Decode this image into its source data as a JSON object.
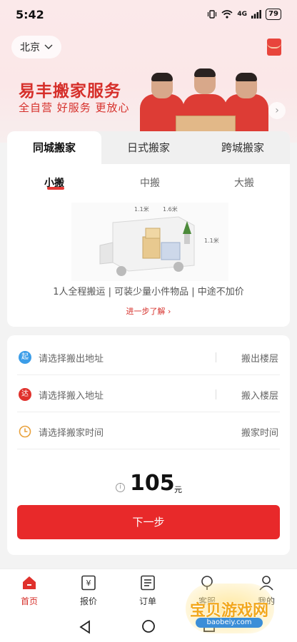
{
  "status_bar": {
    "time": "5:42",
    "network": "4G",
    "battery": "79"
  },
  "header": {
    "city": "北京"
  },
  "banner": {
    "title": "易丰搬家服务",
    "subtitle": "全自营 好服务 更放心"
  },
  "service_tabs": [
    {
      "label": "同城搬家",
      "active": true
    },
    {
      "label": "日式搬家",
      "active": false
    },
    {
      "label": "跨城搬家",
      "active": false
    }
  ],
  "size_tabs": [
    {
      "label": "小搬",
      "active": true
    },
    {
      "label": "中搬",
      "active": false
    },
    {
      "label": "大搬",
      "active": false
    }
  ],
  "truck_dims": {
    "length": "1.1米",
    "width": "1.6米",
    "height": "1.1米"
  },
  "service_desc": "1人全程搬运 | 可装少量小件物品 | 中途不加价",
  "learn_more": "进一步了解",
  "form": {
    "from": {
      "badge": "起",
      "placeholder": "请选择搬出地址",
      "right_label": "搬出楼层"
    },
    "to": {
      "badge": "达",
      "placeholder": "请选择搬入地址",
      "right_label": "搬入楼层"
    },
    "time": {
      "placeholder": "请选择搬家时间",
      "right_label": "搬家时间"
    }
  },
  "price": {
    "value": "105",
    "unit": "元"
  },
  "next_button": "下一步",
  "bottom_nav": [
    {
      "label": "首页",
      "active": true
    },
    {
      "label": "报价",
      "active": false
    },
    {
      "label": "订单",
      "active": false
    },
    {
      "label": "客服",
      "active": false
    },
    {
      "label": "我的",
      "active": false
    }
  ],
  "watermark": {
    "name": "宝贝游戏网",
    "url": "baobeiy.com"
  },
  "colors": {
    "brand_red": "#e8292a",
    "badge_blue": "#3b9de8",
    "badge_red": "#e0312c",
    "clock_orange": "#e9a13b"
  }
}
